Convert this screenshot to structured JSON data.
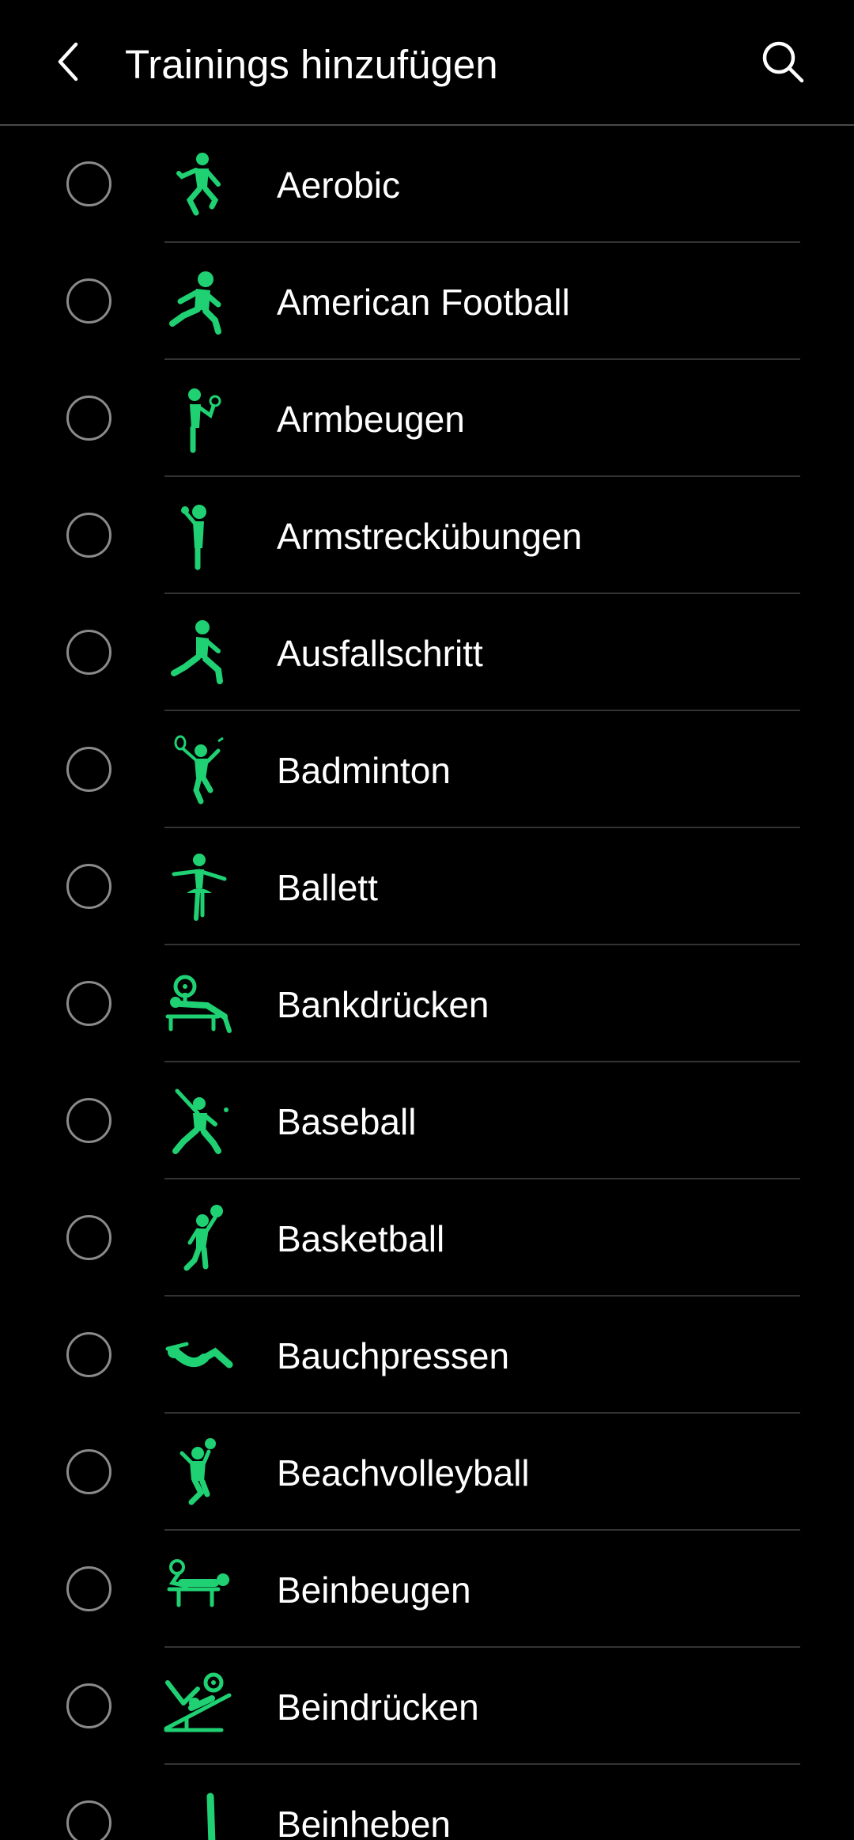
{
  "header": {
    "title": "Trainings hinzufügen",
    "back_icon": "chevron-left-icon",
    "search_icon": "search-icon"
  },
  "colors": {
    "background": "#000000",
    "accent": "#1fd173",
    "text": "#ffffff",
    "radio_border": "#8a8a8a",
    "divider": "#333333"
  },
  "workouts": [
    {
      "label": "Aerobic",
      "icon": "aerobic-icon"
    },
    {
      "label": "American Football",
      "icon": "american-football-icon"
    },
    {
      "label": "Armbeugen",
      "icon": "arm-curl-icon"
    },
    {
      "label": "Armstreckübungen",
      "icon": "arm-extension-icon"
    },
    {
      "label": "Ausfallschritt",
      "icon": "lunge-icon"
    },
    {
      "label": "Badminton",
      "icon": "badminton-icon"
    },
    {
      "label": "Ballett",
      "icon": "ballet-icon"
    },
    {
      "label": "Bankdrücken",
      "icon": "bench-press-icon"
    },
    {
      "label": "Baseball",
      "icon": "baseball-icon"
    },
    {
      "label": "Basketball",
      "icon": "basketball-icon"
    },
    {
      "label": "Bauchpressen",
      "icon": "crunches-icon"
    },
    {
      "label": "Beachvolleyball",
      "icon": "beach-volleyball-icon"
    },
    {
      "label": "Beinbeugen",
      "icon": "leg-curl-icon"
    },
    {
      "label": "Beindrücken",
      "icon": "leg-press-icon"
    },
    {
      "label": "Beinheben",
      "icon": "leg-raise-icon"
    }
  ]
}
